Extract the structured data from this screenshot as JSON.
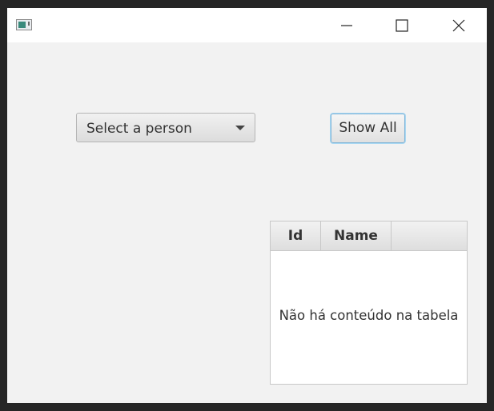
{
  "window": {
    "title": "",
    "controls": {
      "minimize": "minimize-icon",
      "maximize": "maximize-icon",
      "close": "close-icon"
    }
  },
  "person_select": {
    "selected": "Select a person"
  },
  "show_all_button": {
    "label": "Show All"
  },
  "table": {
    "columns": [
      "Id",
      "Name"
    ],
    "rows": [],
    "placeholder": "Não há conteúdo na tabela"
  },
  "colors": {
    "focus_ring": "#7fb4d8",
    "window_bg": "#f2f2f2"
  }
}
